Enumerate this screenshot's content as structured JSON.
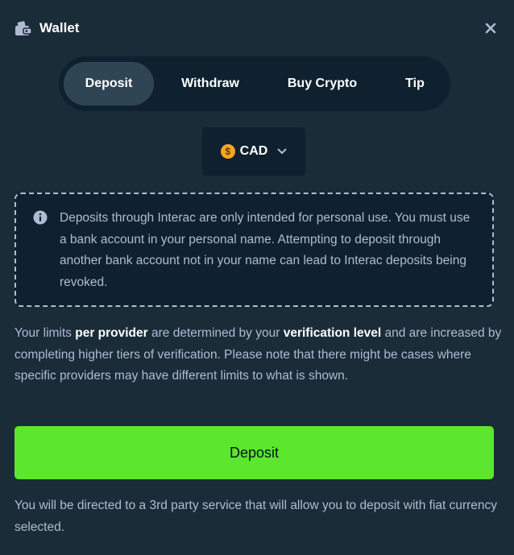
{
  "header": {
    "title": "Wallet",
    "icon": "wallet-icon",
    "close_icon": "close-icon"
  },
  "tabs": [
    {
      "label": "Deposit",
      "active": true
    },
    {
      "label": "Withdraw",
      "active": false
    },
    {
      "label": "Buy Crypto",
      "active": false
    },
    {
      "label": "Tip",
      "active": false
    }
  ],
  "currency": {
    "code": "CAD",
    "symbol": "$",
    "icon": "coin-icon",
    "dropdown_icon": "chevron-down-icon"
  },
  "notice": {
    "icon": "info-icon",
    "text": "Deposits through Interac are only intended for personal use. You must use a bank account in your personal name. Attempting to deposit through another bank account not in your name can lead to Interac deposits being revoked."
  },
  "limits": {
    "part1": "Your limits ",
    "bold1": "per provider",
    "part2": " are determined by your ",
    "bold2": "verification level",
    "part3": " and are increased by completing higher tiers of verification. Please note that there might be cases where specific providers may have different limits to what is shown."
  },
  "deposit_button": {
    "label": "Deposit"
  },
  "footer": {
    "text": "You will be directed to a 3rd party service that will allow you to deposit with fiat currency selected."
  },
  "colors": {
    "background": "#1a2c38",
    "panel": "#0f212e",
    "active_tab": "#2f4553",
    "accent": "#5ce62e",
    "text_muted": "#b1bad3",
    "coin": "#f5a623"
  }
}
